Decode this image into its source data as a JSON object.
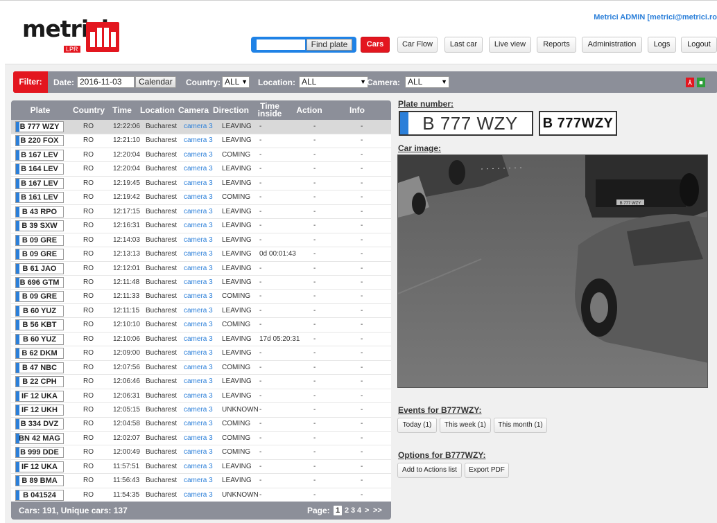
{
  "brand": {
    "logo_text": "metrici",
    "logo_sub": "LPR"
  },
  "user": {
    "info": "Metrici ADMIN [metrici@metrici.ro"
  },
  "search": {
    "placeholder": "",
    "value": "",
    "button": "Find plate"
  },
  "nav": {
    "cars": "Cars",
    "car_flow": "Car Flow",
    "last_car": "Last car",
    "live_view": "Live view",
    "reports": "Reports",
    "administration": "Administration",
    "logs": "Logs",
    "logout": "Logout"
  },
  "filter": {
    "label": "Filter:",
    "date_label": "Date:",
    "date_value": "2016-11-03",
    "calendar_button": "Calendar",
    "country_label": "Country:",
    "country_value": "ALL",
    "location_label": "Location:",
    "location_value": "ALL",
    "camera_label": "Camera:",
    "camera_value": "ALL",
    "pdf_icon": "pdf-export-icon",
    "xls_icon": "excel-export-icon"
  },
  "table": {
    "headers": [
      "Plate",
      "Country",
      "Time",
      "Location",
      "Camera",
      "Direction",
      "Time inside",
      "Action",
      "Info"
    ],
    "rows": [
      {
        "plate": "B 777 WZY",
        "country": "RO",
        "time": "12:22:06",
        "location": "Bucharest",
        "camera": "camera 3",
        "direction": "LEAVING",
        "inside": "-",
        "action": "-",
        "info": "-"
      },
      {
        "plate": "B 220 FOX",
        "country": "RO",
        "time": "12:21:10",
        "location": "Bucharest",
        "camera": "camera 3",
        "direction": "LEAVING",
        "inside": "-",
        "action": "-",
        "info": "-"
      },
      {
        "plate": "B 167 LEV",
        "country": "RO",
        "time": "12:20:04",
        "location": "Bucharest",
        "camera": "camera 3",
        "direction": "COMING",
        "inside": "-",
        "action": "-",
        "info": "-"
      },
      {
        "plate": "B 164 LEV",
        "country": "RO",
        "time": "12:20:04",
        "location": "Bucharest",
        "camera": "camera 3",
        "direction": "LEAVING",
        "inside": "-",
        "action": "-",
        "info": "-"
      },
      {
        "plate": "B 167 LEV",
        "country": "RO",
        "time": "12:19:45",
        "location": "Bucharest",
        "camera": "camera 3",
        "direction": "LEAVING",
        "inside": "-",
        "action": "-",
        "info": "-"
      },
      {
        "plate": "B 161 LEV",
        "country": "RO",
        "time": "12:19:42",
        "location": "Bucharest",
        "camera": "camera 3",
        "direction": "COMING",
        "inside": "-",
        "action": "-",
        "info": "-"
      },
      {
        "plate": "B 43 RPO",
        "country": "RO",
        "time": "12:17:15",
        "location": "Bucharest",
        "camera": "camera 3",
        "direction": "LEAVING",
        "inside": "-",
        "action": "-",
        "info": "-"
      },
      {
        "plate": "B 39 SXW",
        "country": "RO",
        "time": "12:16:31",
        "location": "Bucharest",
        "camera": "camera 3",
        "direction": "LEAVING",
        "inside": "-",
        "action": "-",
        "info": "-"
      },
      {
        "plate": "B 09 GRE",
        "country": "RO",
        "time": "12:14:03",
        "location": "Bucharest",
        "camera": "camera 3",
        "direction": "LEAVING",
        "inside": "-",
        "action": "-",
        "info": "-"
      },
      {
        "plate": "B 09 GRE",
        "country": "RO",
        "time": "12:13:13",
        "location": "Bucharest",
        "camera": "camera 3",
        "direction": "LEAVING",
        "inside": "0d 00:01:43",
        "action": "-",
        "info": "-"
      },
      {
        "plate": "B 61 JAO",
        "country": "RO",
        "time": "12:12:01",
        "location": "Bucharest",
        "camera": "camera 3",
        "direction": "LEAVING",
        "inside": "-",
        "action": "-",
        "info": "-"
      },
      {
        "plate": "B 696 GTM",
        "country": "RO",
        "time": "12:11:48",
        "location": "Bucharest",
        "camera": "camera 3",
        "direction": "LEAVING",
        "inside": "-",
        "action": "-",
        "info": "-"
      },
      {
        "plate": "B 09 GRE",
        "country": "RO",
        "time": "12:11:33",
        "location": "Bucharest",
        "camera": "camera 3",
        "direction": "COMING",
        "inside": "-",
        "action": "-",
        "info": "-"
      },
      {
        "plate": "B 60 YUZ",
        "country": "RO",
        "time": "12:11:15",
        "location": "Bucharest",
        "camera": "camera 3",
        "direction": "LEAVING",
        "inside": "-",
        "action": "-",
        "info": "-"
      },
      {
        "plate": "B 56 KBT",
        "country": "RO",
        "time": "12:10:10",
        "location": "Bucharest",
        "camera": "camera 3",
        "direction": "COMING",
        "inside": "-",
        "action": "-",
        "info": "-"
      },
      {
        "plate": "B 60 YUZ",
        "country": "RO",
        "time": "12:10:06",
        "location": "Bucharest",
        "camera": "camera 3",
        "direction": "LEAVING",
        "inside": "17d 05:20:31",
        "action": "-",
        "info": "-"
      },
      {
        "plate": "B 62 DKM",
        "country": "RO",
        "time": "12:09:00",
        "location": "Bucharest",
        "camera": "camera 3",
        "direction": "LEAVING",
        "inside": "-",
        "action": "-",
        "info": "-"
      },
      {
        "plate": "B 47 NBC",
        "country": "RO",
        "time": "12:07:56",
        "location": "Bucharest",
        "camera": "camera 3",
        "direction": "COMING",
        "inside": "-",
        "action": "-",
        "info": "-"
      },
      {
        "plate": "B 22 CPH",
        "country": "RO",
        "time": "12:06:46",
        "location": "Bucharest",
        "camera": "camera 3",
        "direction": "LEAVING",
        "inside": "-",
        "action": "-",
        "info": "-"
      },
      {
        "plate": "IF 12 UKA",
        "country": "RO",
        "time": "12:06:31",
        "location": "Bucharest",
        "camera": "camera 3",
        "direction": "LEAVING",
        "inside": "-",
        "action": "-",
        "info": "-"
      },
      {
        "plate": "IF 12 UKH",
        "country": "RO",
        "time": "12:05:15",
        "location": "Bucharest",
        "camera": "camera 3",
        "direction": "UNKNOWN",
        "inside": "-",
        "action": "-",
        "info": "-"
      },
      {
        "plate": "B 334 DVZ",
        "country": "RO",
        "time": "12:04:58",
        "location": "Bucharest",
        "camera": "camera 3",
        "direction": "COMING",
        "inside": "-",
        "action": "-",
        "info": "-"
      },
      {
        "plate": "BN 42 MAG",
        "country": "RO",
        "time": "12:02:07",
        "location": "Bucharest",
        "camera": "camera 3",
        "direction": "COMING",
        "inside": "-",
        "action": "-",
        "info": "-"
      },
      {
        "plate": "B 999 DDE",
        "country": "RO",
        "time": "12:00:49",
        "location": "Bucharest",
        "camera": "camera 3",
        "direction": "COMING",
        "inside": "-",
        "action": "-",
        "info": "-"
      },
      {
        "plate": "IF 12 UKA",
        "country": "RO",
        "time": "11:57:51",
        "location": "Bucharest",
        "camera": "camera 3",
        "direction": "LEAVING",
        "inside": "-",
        "action": "-",
        "info": "-"
      },
      {
        "plate": "B 89 BMA",
        "country": "RO",
        "time": "11:56:43",
        "location": "Bucharest",
        "camera": "camera 3",
        "direction": "LEAVING",
        "inside": "-",
        "action": "-",
        "info": "-"
      },
      {
        "plate": "B 041524",
        "country": "RO",
        "time": "11:54:35",
        "location": "Bucharest",
        "camera": "camera 3",
        "direction": "UNKNOWN",
        "inside": "-",
        "action": "-",
        "info": "-"
      }
    ],
    "footer": "Cars: 191, Unique cars: 137",
    "page_label": "Page:",
    "pages": [
      "1",
      "2",
      "3",
      "4",
      ">",
      ">>"
    ],
    "current_page": "1"
  },
  "detail": {
    "plate_number_title": "Plate number:",
    "plate_text": "B 777 WZY",
    "plate_ocr": "B 777WZY",
    "car_image_title": "Car image:",
    "car_plate_in_image": "B 777 WZY",
    "events_title": "Events for B777WZY:",
    "events_buttons": [
      "Today (1)",
      "This week (1)",
      "This month (1)"
    ],
    "options_title": "Options for B777WZY:",
    "options_buttons": [
      "Add to Actions list",
      "Export PDF"
    ]
  },
  "colors": {
    "brand_red": "#e3161f",
    "accent_blue": "#2b7fd9",
    "header_gray": "#8c8f99"
  }
}
